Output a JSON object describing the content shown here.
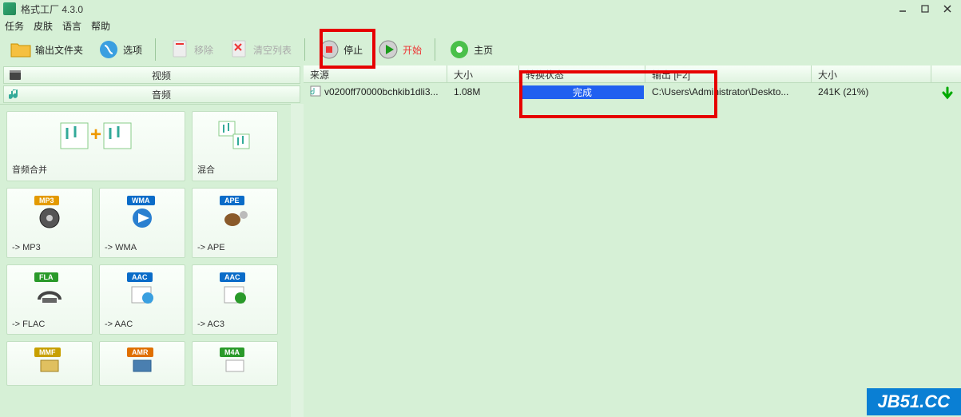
{
  "window": {
    "title": "格式工厂 4.3.0"
  },
  "menu": [
    "任务",
    "皮肤",
    "语言",
    "帮助"
  ],
  "toolbar": {
    "output_folder": "输出文件夹",
    "options": "选项",
    "remove": "移除",
    "clear": "清空列表",
    "stop": "停止",
    "start": "开始",
    "home": "主页"
  },
  "categories": {
    "video": "视频",
    "audio": "音频"
  },
  "formats": {
    "merge": "音频合并",
    "mix": "混合",
    "mp3": "-> MP3",
    "wma": "-> WMA",
    "ape": "-> APE",
    "flac": "-> FLAC",
    "aac": "-> AAC",
    "ac3": "-> AC3",
    "mmf": "MMF",
    "amr": "AMR",
    "m4a": "M4A"
  },
  "badges": {
    "mp3": "MP3",
    "wma": "WMA",
    "ape": "APE",
    "fla": "FLA",
    "aac": "AAC",
    "mmf": "MMF",
    "amr": "AMR",
    "m4a": "M4A"
  },
  "colors": {
    "mp3": "#e39a00",
    "wma": "#0a6cc8",
    "ape": "#0a6cc8",
    "fla": "#2a9a2a",
    "aac": "#0a6cc8",
    "mmf": "#c8a000",
    "amr": "#e07000",
    "m4a": "#2a9a2a"
  },
  "table": {
    "headers": {
      "source": "来源",
      "size": "大小",
      "status": "转换状态",
      "output": "输出 [F2]",
      "out_size": "大小"
    },
    "rows": [
      {
        "source": "v0200ff70000bchkib1dli3...",
        "size": "1.08M",
        "status": "完成",
        "output": "C:\\Users\\Administrator\\Deskto...",
        "out_size": "241K (21%)"
      }
    ]
  },
  "watermark": "JB51.CC"
}
